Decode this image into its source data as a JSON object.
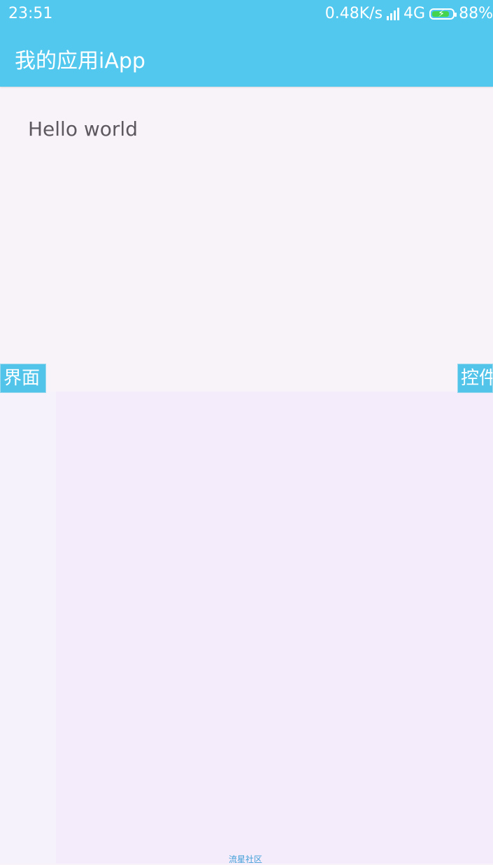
{
  "status_bar": {
    "time": "23:51",
    "network_speed": "0.48K/s",
    "network_type": "4G",
    "battery_percent": "88%",
    "icons": [
      "signal-icon",
      "battery-charging-icon"
    ]
  },
  "app_bar": {
    "title": "我的应用iApp",
    "color": "#53c8ee"
  },
  "content": {
    "hello_text": "Hello world"
  },
  "side_tabs": {
    "left_label": "界面",
    "right_label": "控件"
  },
  "footer": {
    "link_text": "流星社区"
  }
}
